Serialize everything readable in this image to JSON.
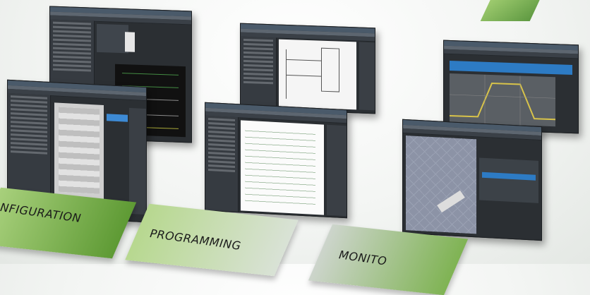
{
  "labels": {
    "configuration": "NFIGURATION",
    "programming": "PROGRAMMING",
    "monitoring": "MONITO"
  },
  "colors": {
    "band_green_dark": "#5e9a34",
    "band_green_light": "#b7d88f",
    "band_gray": "#cdd5cc",
    "window_dark": "#2b2f33",
    "trace_yellow": "#d8c34a"
  },
  "windows": [
    {
      "name": "configuration-window"
    },
    {
      "name": "variables-window"
    },
    {
      "name": "ladder-window"
    },
    {
      "name": "st-code-window"
    },
    {
      "name": "trace-window"
    },
    {
      "name": "simulation-3d-window"
    }
  ]
}
